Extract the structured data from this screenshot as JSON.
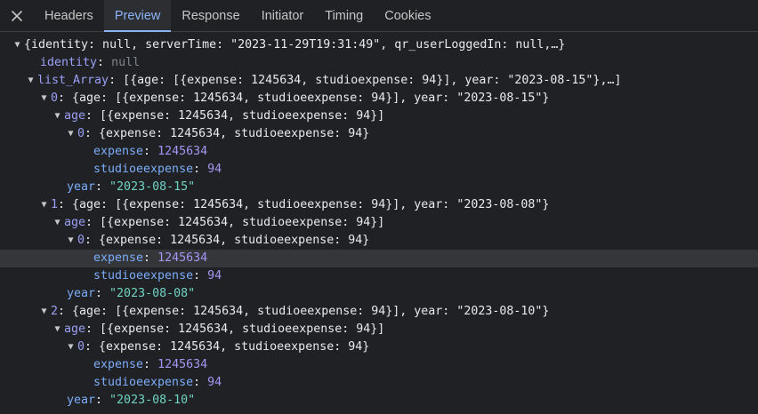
{
  "tabs": {
    "close_label": "✕",
    "headers": "Headers",
    "preview": "Preview",
    "response": "Response",
    "initiator": "Initiator",
    "timing": "Timing",
    "cookies": "Cookies"
  },
  "tree": {
    "root_summary": "{identity: null, serverTime: \"2023-11-29T19:31:49\", qr_userLoggedIn: null,…}",
    "identity_key": "identity",
    "identity_value": "null",
    "list_key": "list_Array",
    "list_summary": "[{age: [{expense: 1245634, studioexpense: 94}], year: \"2023-08-15\"},…]",
    "items": [
      {
        "index": "0",
        "summary": "{age: [{expense: 1245634, studioeexpense: 94}], year: \"2023-08-15\"}",
        "age_key": "age",
        "age_summary": "[{expense: 1245634, studioeexpense: 94}]",
        "entry_index": "0",
        "entry_summary": "{expense: 1245634, studioeexpense: 94}",
        "expense_key": "expense",
        "expense_value": "1245634",
        "studio_key": "studioeexpense",
        "studio_value": "94",
        "year_key": "year",
        "year_value": "\"2023-08-15\""
      },
      {
        "index": "1",
        "summary": "{age: [{expense: 1245634, studioeexpense: 94}], year: \"2023-08-08\"}",
        "age_key": "age",
        "age_summary": "[{expense: 1245634, studioeexpense: 94}]",
        "entry_index": "0",
        "entry_summary": "{expense: 1245634, studioeexpense: 94}",
        "expense_key": "expense",
        "expense_value": "1245634",
        "studio_key": "studioeexpense",
        "studio_value": "94",
        "year_key": "year",
        "year_value": "\"2023-08-08\""
      },
      {
        "index": "2",
        "summary": "{age: [{expense: 1245634, studioeexpense: 94}], year: \"2023-08-10\"}",
        "age_key": "age",
        "age_summary": "[{expense: 1245634, studioeexpense: 94}]",
        "entry_index": "0",
        "entry_summary": "{expense: 1245634, studioeexpense: 94}",
        "expense_key": "expense",
        "expense_value": "1245634",
        "studio_key": "studioeexpense",
        "studio_value": "94",
        "year_key": "year",
        "year_value": "\"2023-08-10\""
      }
    ]
  }
}
